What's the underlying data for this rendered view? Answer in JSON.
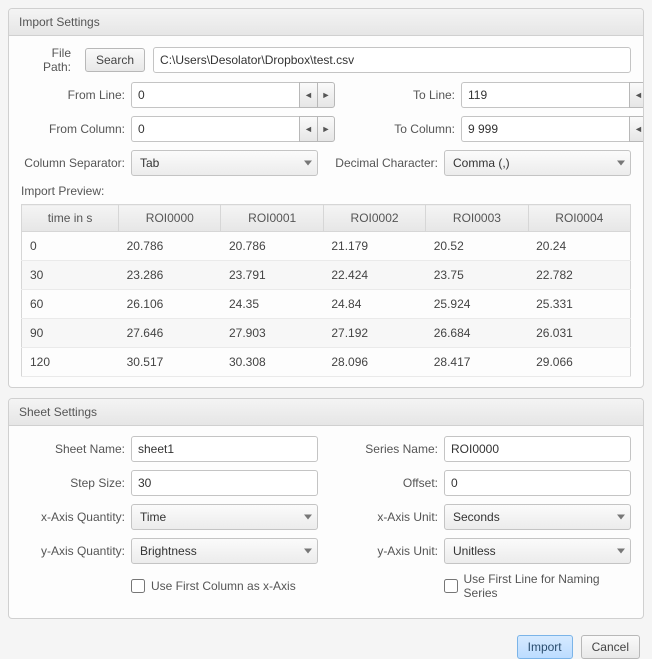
{
  "panels": {
    "import_title": "Import Settings",
    "sheet_title": "Sheet Settings"
  },
  "import": {
    "file_path_label": "File Path:",
    "search_label": "Search",
    "file_path": "C:\\Users\\Desolator\\Dropbox\\test.csv",
    "from_line_label": "From Line:",
    "from_line": "0",
    "to_line_label": "To Line:",
    "to_line": "119",
    "from_column_label": "From Column:",
    "from_column": "0",
    "to_column_label": "To Column:",
    "to_column": "9 999",
    "column_separator_label": "Column Separator:",
    "column_separator": "Tab",
    "decimal_character_label": "Decimal Character:",
    "decimal_character": "Comma (,)",
    "preview_label": "Import Preview:"
  },
  "preview": {
    "headers": [
      "time in s",
      "ROI0000",
      "ROI0001",
      "ROI0002",
      "ROI0003",
      "ROI0004"
    ],
    "rows": [
      [
        "0",
        "20.786",
        "20.786",
        "21.179",
        "20.52",
        "20.24"
      ],
      [
        "30",
        "23.286",
        "23.791",
        "22.424",
        "23.75",
        "22.782"
      ],
      [
        "60",
        "26.106",
        "24.35",
        "24.84",
        "25.924",
        "25.331"
      ],
      [
        "90",
        "27.646",
        "27.903",
        "27.192",
        "26.684",
        "26.031"
      ],
      [
        "120",
        "30.517",
        "30.308",
        "28.096",
        "28.417",
        "29.066"
      ]
    ]
  },
  "sheet": {
    "sheet_name_label": "Sheet Name:",
    "sheet_name": "sheet1",
    "series_name_label": "Series Name:",
    "series_name": "ROI0000",
    "step_size_label": "Step Size:",
    "step_size": "30",
    "offset_label": "Offset:",
    "offset": "0",
    "x_axis_quantity_label": "x-Axis Quantity:",
    "x_axis_quantity": "Time",
    "x_axis_unit_label": "x-Axis Unit:",
    "x_axis_unit": "Seconds",
    "y_axis_quantity_label": "y-Axis Quantity:",
    "y_axis_quantity": "Brightness",
    "y_axis_unit_label": "y-Axis Unit:",
    "y_axis_unit": "Unitless",
    "use_first_col_label": "Use First Column as x-Axis",
    "use_first_line_label": "Use First Line for Naming Series"
  },
  "footer": {
    "import_label": "Import",
    "cancel_label": "Cancel"
  }
}
